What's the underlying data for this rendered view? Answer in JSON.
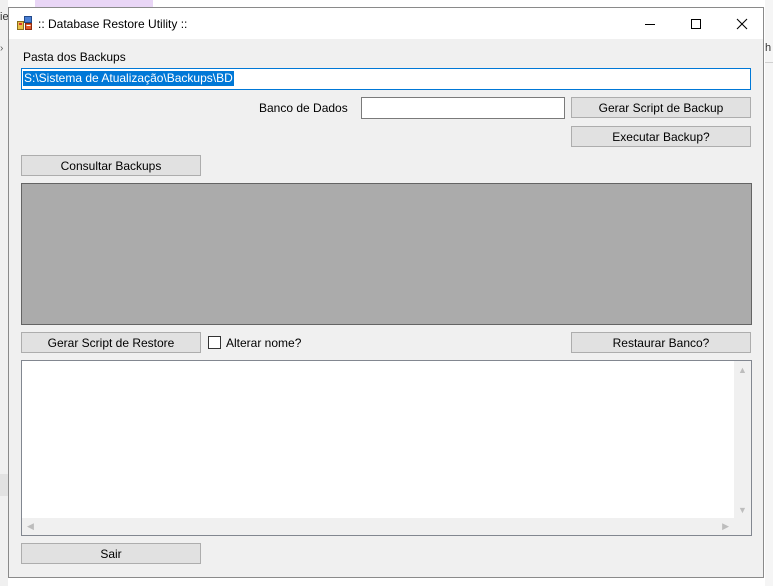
{
  "background": {
    "left_text": "ie",
    "left_arrow": "›",
    "right_text": "h"
  },
  "window": {
    "title": ":: Database Restore Utility ::",
    "controls": {
      "minimize": "minimize",
      "maximize": "maximize",
      "close": "close"
    }
  },
  "backup_folder": {
    "label": "Pasta dos Backups",
    "value": "S:\\Sistema de Atualização\\Backups\\BD"
  },
  "database": {
    "label": "Banco de Dados",
    "value": ""
  },
  "buttons": {
    "generate_backup_script": "Gerar Script de Backup",
    "execute_backup": "Executar Backup?",
    "query_backups": "Consultar Backups",
    "generate_restore_script": "Gerar Script de Restore",
    "restore_database": "Restaurar Banco?",
    "exit": "Sair"
  },
  "rename_checkbox": {
    "label": "Alterar nome?",
    "checked": false
  },
  "script_output": {
    "value": ""
  },
  "colors": {
    "selection": "#0078d7",
    "grid_background": "#ababab",
    "button_face": "#e1e1e1",
    "window_background": "#f0f0f0"
  }
}
